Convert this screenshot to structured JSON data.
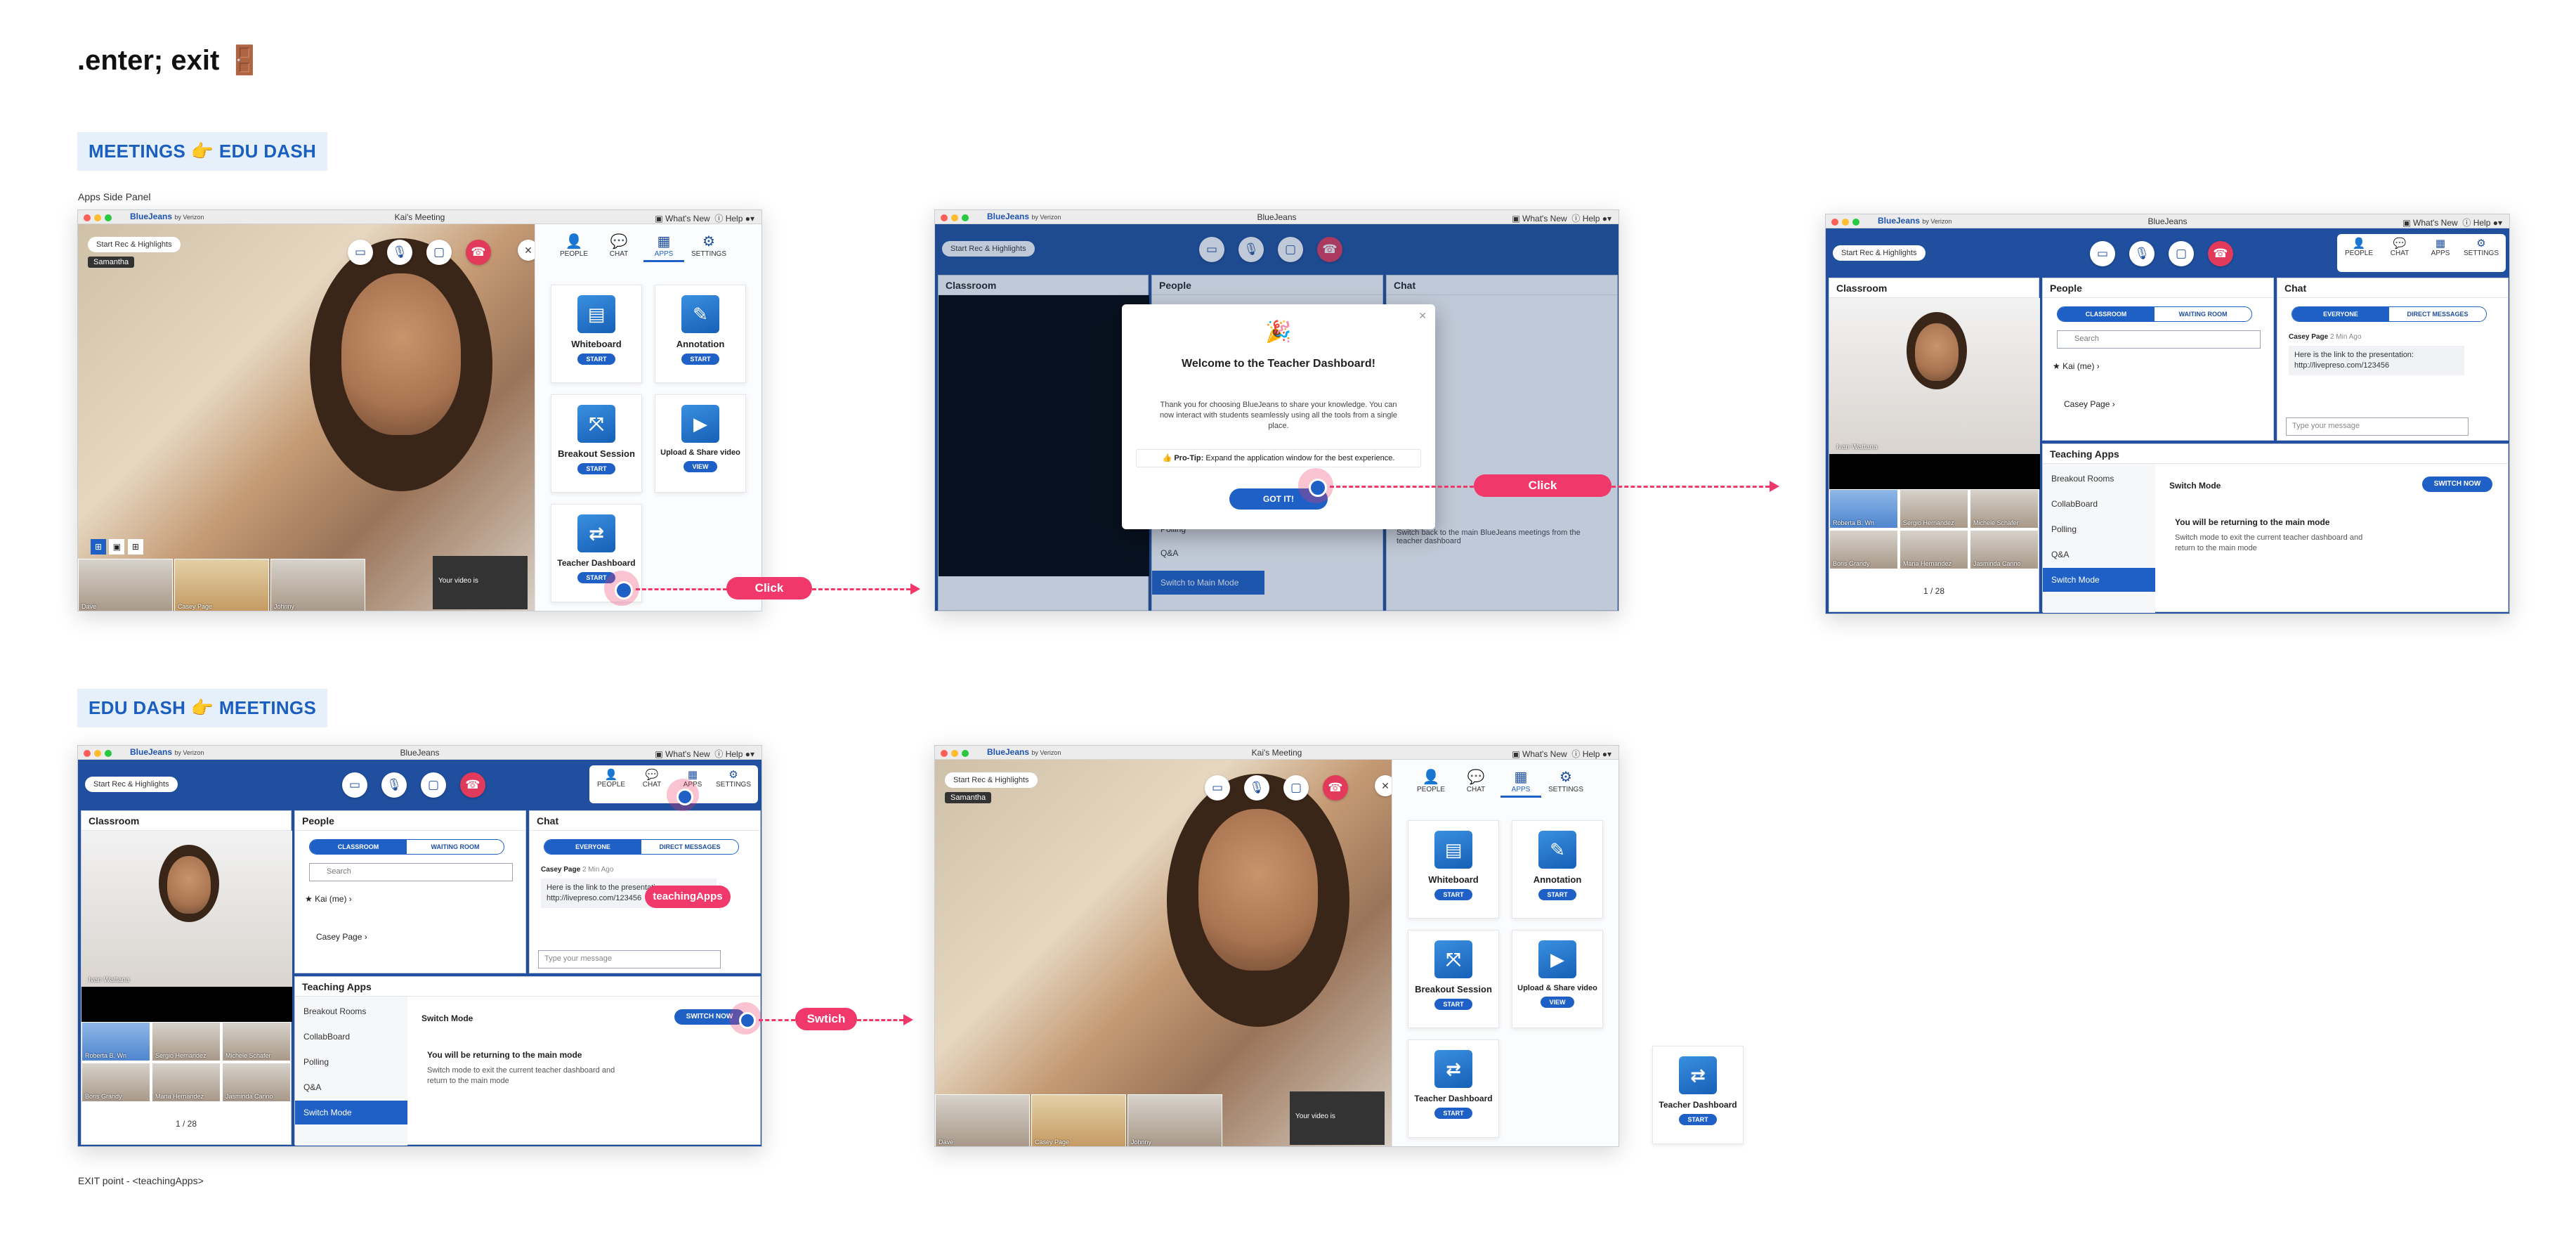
{
  "page_title": ".enter; exit 🚪",
  "sections": {
    "meet_to_edu": "MEETINGS 👉 EDU DASH",
    "edu_to_meet": "EDU DASH 👉 MEETINGS"
  },
  "caption_apps_panel": "Apps Side Panel",
  "exit_note": "EXIT point - <teachingApps>",
  "window": {
    "brand": "BlueJeans",
    "brand_by": "by Verizon",
    "title_meeting": "Kai's Meeting",
    "title_bluejeans": "BlueJeans",
    "whats_new": "What's New",
    "help": "Help"
  },
  "toolbar": {
    "start_rec": "Start Rec & Highlights",
    "tabs": [
      "PEOPLE",
      "CHAT",
      "APPS",
      "SETTINGS"
    ]
  },
  "apps": [
    {
      "name": "Whiteboard",
      "action": "START",
      "icon": "whiteboard-icon"
    },
    {
      "name": "Annotation",
      "action": "START",
      "icon": "annotation-icon"
    },
    {
      "name": "Breakout Session",
      "action": "START",
      "icon": "breakout-icon"
    },
    {
      "name": "Upload & Share video",
      "action": "VIEW",
      "icon": "video-share-icon"
    },
    {
      "name": "Teacher Dashboard",
      "action": "START",
      "icon": "dashboard-icon"
    }
  ],
  "video": {
    "speaker_name": "Samantha",
    "your_video": "Your video is",
    "thumbs": [
      "Dave",
      "Casey Page",
      "Johnny"
    ]
  },
  "modal": {
    "title": "Welcome to the Teacher Dashboard!",
    "body": "Thank you for choosing BlueJeans to share your knowledge. You can now interact with students seamlessly using all the tools from a single place.",
    "protip_label": "Pro-Tip:",
    "protip": "Expand the application window for the best experience.",
    "button": "GOT IT!"
  },
  "dashboard": {
    "classroom": "Classroom",
    "people": "People",
    "chat": "Chat",
    "seg_people": [
      "CLASSROOM",
      "WAITING ROOM"
    ],
    "seg_chat": [
      "EVERYONE",
      "DIRECT MESSAGES"
    ],
    "search": "Search",
    "person_me": "Kai (me)",
    "person_casey": "Casey Page",
    "chat_sender": "Casey Page",
    "chat_time": "2 Min Ago",
    "chat_msg": "Here is the link to the presentation: http://livepreso.com/123456",
    "chat_placeholder": "Type your message",
    "teaching_apps": "Teaching Apps",
    "apps_list": [
      "Breakout Rooms",
      "CollabBoard",
      "Polling",
      "Q&A",
      "Switch Mode"
    ],
    "switch_title": "Switch Mode",
    "switch_btn": "SWITCH NOW",
    "switch_heading": "You will be returning to the main mode",
    "switch_desc": "Switch mode to exit the current teacher dashboard and return to the main mode",
    "switch_back": "Switch back to the main BlueJeans meetings from the teacher dashboard",
    "main_mode": "Switch to Main Mode",
    "pager": "1 / 28",
    "tile_name": "Ivan Wattana",
    "grid_names": [
      "Roberta B. Wn",
      "Sergio Hernandez",
      "Michele Schafer",
      "Boris Grandy",
      "Maria Hernandez",
      "Jasminda Carino"
    ]
  },
  "annotations": {
    "click": "Click",
    "switch": "Swtich",
    "teaching_apps": "teachingApps"
  },
  "colors": {
    "brand_blue": "#1f4f9e",
    "accent_blue": "#1f60c6",
    "pink": "#f0386b",
    "end_call": "#e23a5b"
  }
}
